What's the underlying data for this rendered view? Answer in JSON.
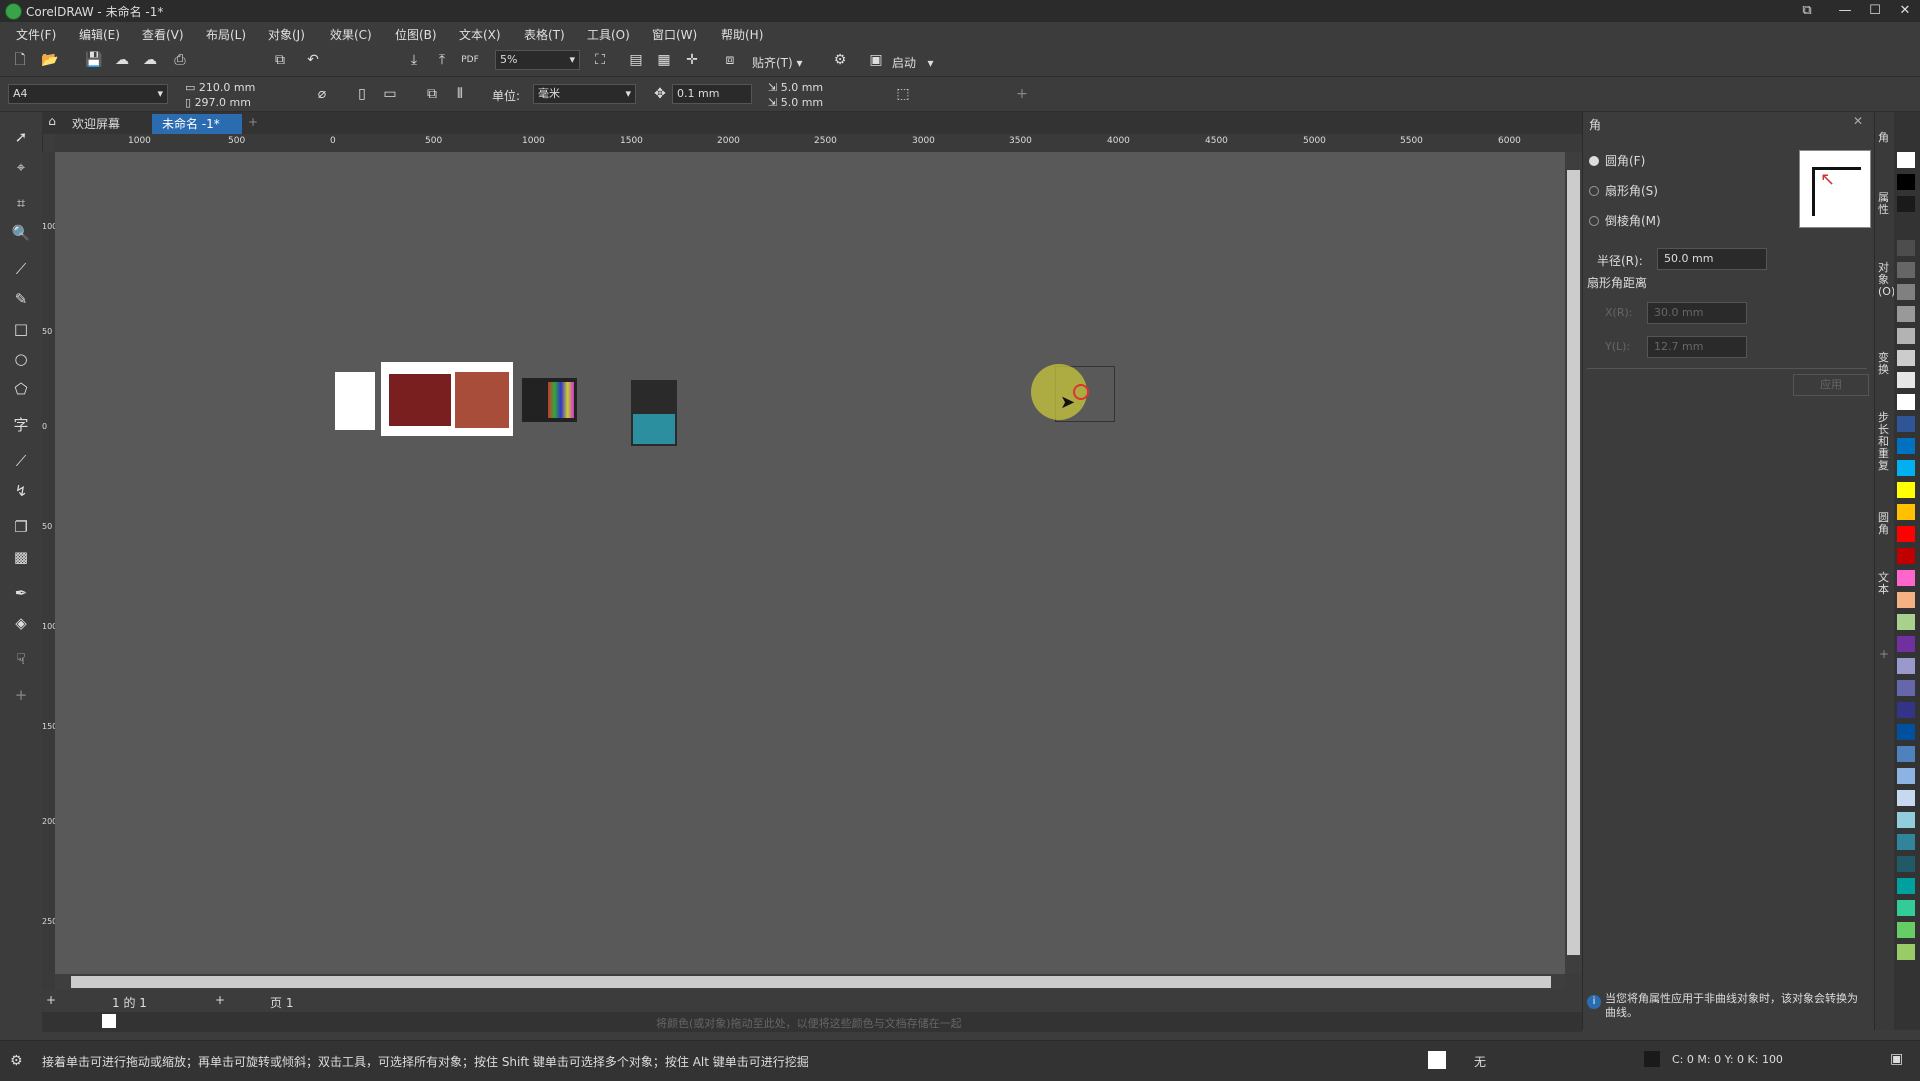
{
  "window": {
    "title": "CorelDRAW - 未命名 -1*"
  },
  "menu": [
    "文件(F)",
    "编辑(E)",
    "查看(V)",
    "布局(L)",
    "对象(J)",
    "效果(C)",
    "位图(B)",
    "文本(X)",
    "表格(T)",
    "工具(O)",
    "窗口(W)",
    "帮助(H)"
  ],
  "toolbar": {
    "zoom": "5%",
    "snap": "贴齐(T)",
    "launch": "启动"
  },
  "propbar": {
    "page_size": "A4",
    "width": "210.0 mm",
    "height": "297.0 mm",
    "unit_label": "单位:",
    "unit": "毫米",
    "nudge": "0.1 mm",
    "dup_x": "5.0 mm",
    "dup_y": "5.0 mm"
  },
  "tabs": {
    "welcome": "欢迎屏幕",
    "doc": "未命名 -1*"
  },
  "ruler_h": [
    "1000",
    "500",
    "0",
    "500",
    "1000",
    "1500",
    "2000",
    "2500",
    "3000",
    "3500",
    "4000",
    "4500",
    "5000",
    "5500",
    "6000"
  ],
  "ruler_v": [
    "100",
    "50",
    "0",
    "50",
    "100",
    "150",
    "200",
    "250"
  ],
  "pagebar": {
    "page_count": "1 的 1",
    "page_name": "页 1"
  },
  "doc_hint": "将颜色(或对象)拖动至此处，以便将这些颜色与文档存储在一起",
  "status": {
    "message": "接着单击可进行拖动或缩放；再单击可旋转或倾斜；双击工具，可选择所有对象；按住 Shift 键单击可选择多个对象；按住 Alt 键单击可进行挖掘",
    "fill": "无",
    "color": "C: 0 M: 0 Y: 0 K: 100"
  },
  "docker": {
    "title": "角",
    "options": [
      "圆角(F)",
      "扇形角(S)",
      "倒棱角(M)"
    ],
    "radius_label": "半径(R):",
    "radius_value": "50.0 mm",
    "scallop_label": "扇形角距离",
    "field1_label": "X(R):",
    "field1": "30.0 mm",
    "field2_label": "Y(L):",
    "field2": "12.7 mm",
    "apply": "应用",
    "info": "当您将角属性应用于非曲线对象时，该对象会转换为曲线。"
  },
  "sidetabs": [
    "角",
    "属性",
    "对象(O)",
    "变换",
    "步长和重复",
    "圆角",
    "文本"
  ],
  "palette": [
    "#ffffff",
    "#000000",
    "#1a1a1a",
    "#333333",
    "#4d4d4d",
    "#666666",
    "#808080",
    "#999999",
    "#b3b3b3",
    "#cccccc",
    "#e6e6e6",
    "#ffffff",
    "#2f5597",
    "#0070c0",
    "#00b0f0",
    "#ffff00",
    "#ffc000",
    "#ff0000",
    "#c00000",
    "#ff66cc",
    "#f4b183",
    "#a9d18e",
    "#7030a0",
    "#9999cc",
    "#6666aa",
    "#333388",
    "#0050a0",
    "#4f81bd",
    "#8db3e2",
    "#c6d9f1",
    "#92cddc",
    "#31859b",
    "#215968",
    "#00a0a0",
    "#33cc99",
    "#66cc66",
    "#99cc66"
  ]
}
